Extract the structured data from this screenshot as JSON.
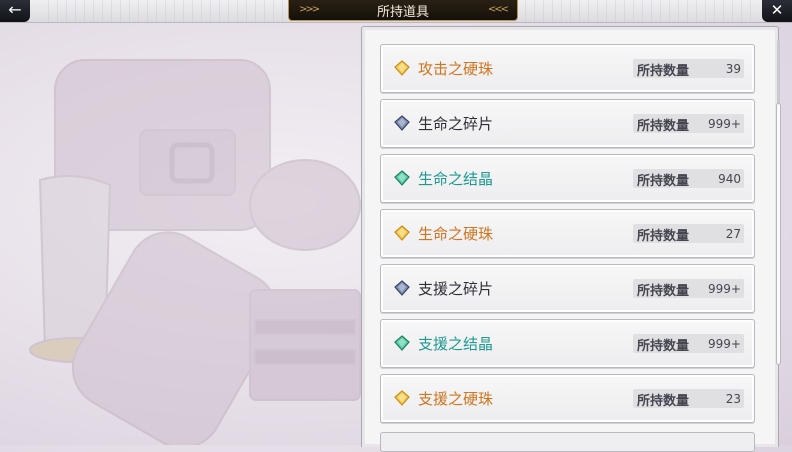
{
  "header": {
    "title": "所持道具",
    "back_icon": "arrow-left-icon",
    "close_icon": "close-icon"
  },
  "colors": {
    "orange": "#d0741e",
    "dark": "#2e2e36",
    "teal": "#1f9990"
  },
  "items": [
    {
      "name": "攻击之硬珠",
      "qty_label": "所持数量",
      "qty": "39",
      "color": "#d0741e",
      "icon": "gold-gem-icon"
    },
    {
      "name": "生命之碎片",
      "qty_label": "所持数量",
      "qty": "999+",
      "color": "#2e2e36",
      "icon": "blue-gem-icon"
    },
    {
      "name": "生命之结晶",
      "qty_label": "所持数量",
      "qty": "940",
      "color": "#1f9990",
      "icon": "green-gem-icon"
    },
    {
      "name": "生命之硬珠",
      "qty_label": "所持数量",
      "qty": "27",
      "color": "#d0741e",
      "icon": "gold-gem-icon"
    },
    {
      "name": "支援之碎片",
      "qty_label": "所持数量",
      "qty": "999+",
      "color": "#2e2e36",
      "icon": "blue-gem-icon"
    },
    {
      "name": "支援之结晶",
      "qty_label": "所持数量",
      "qty": "999+",
      "color": "#1f9990",
      "icon": "green-gem-icon"
    },
    {
      "name": "支援之硬珠",
      "qty_label": "所持数量",
      "qty": "23",
      "color": "#d0741e",
      "icon": "gold-gem-icon"
    }
  ]
}
